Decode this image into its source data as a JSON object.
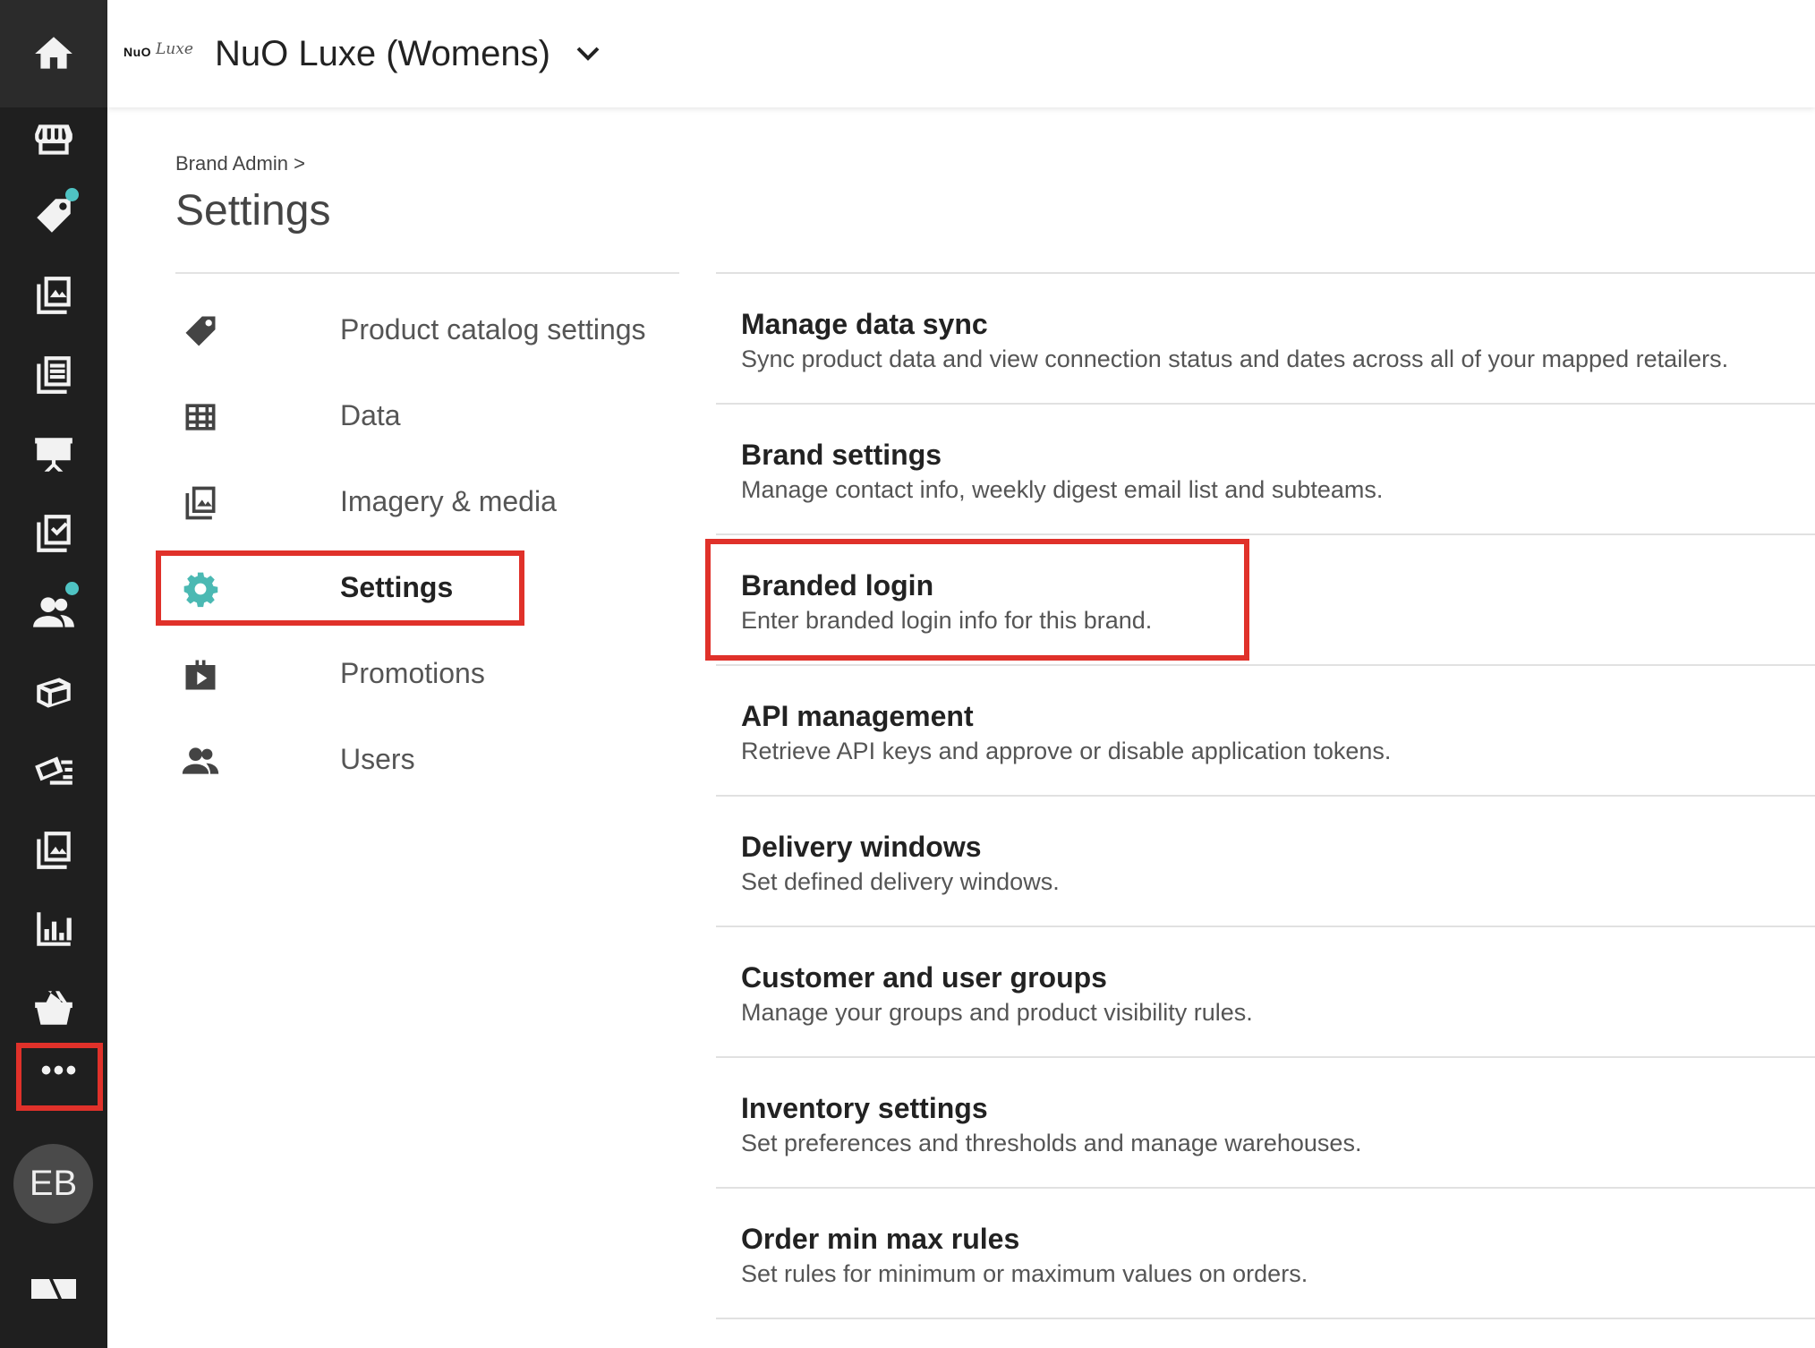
{
  "header": {
    "logo_main": "NuO",
    "logo_script": "Luxe",
    "brand_name": "NuO Luxe (Womens)"
  },
  "breadcrumb": "Brand Admin >",
  "page_title": "Settings",
  "rail": {
    "icons": [
      "home-icon",
      "store-icon",
      "tag-icon",
      "catalog-icon",
      "list-icon",
      "presentation-icon",
      "checklist-icon",
      "users-icon",
      "box-icon",
      "mail-icon",
      "images-icon",
      "chart-icon",
      "basket-icon"
    ],
    "more_label": "•••",
    "avatar_initials": "EB"
  },
  "subnav": [
    {
      "label": "Product catalog settings",
      "icon": "tag-icon"
    },
    {
      "label": "Data",
      "icon": "table-icon"
    },
    {
      "label": "Imagery & media",
      "icon": "images-icon"
    },
    {
      "label": "Settings",
      "icon": "gear-icon",
      "active": true
    },
    {
      "label": "Promotions",
      "icon": "promotion-icon"
    },
    {
      "label": "Users",
      "icon": "users-icon"
    }
  ],
  "settings_list": [
    {
      "title": "Manage data sync",
      "desc": "Sync product data and view connection status and dates across all of your mapped retailers."
    },
    {
      "title": "Brand settings",
      "desc": "Manage contact info, weekly digest email list and subteams."
    },
    {
      "title": "Branded login",
      "desc": "Enter branded login info for this brand."
    },
    {
      "title": "API management",
      "desc": "Retrieve API keys and approve or disable application tokens."
    },
    {
      "title": "Delivery windows",
      "desc": "Set defined delivery windows."
    },
    {
      "title": "Customer and user groups",
      "desc": "Manage your groups and product visibility rules."
    },
    {
      "title": "Inventory settings",
      "desc": "Set preferences and thresholds and manage warehouses."
    },
    {
      "title": "Order min max rules",
      "desc": "Set rules for minimum or maximum values on orders."
    }
  ],
  "colors": {
    "rail_bg": "#1f1f1f",
    "accent_teal": "#4bb9b3",
    "highlight_red": "#e0312a"
  }
}
